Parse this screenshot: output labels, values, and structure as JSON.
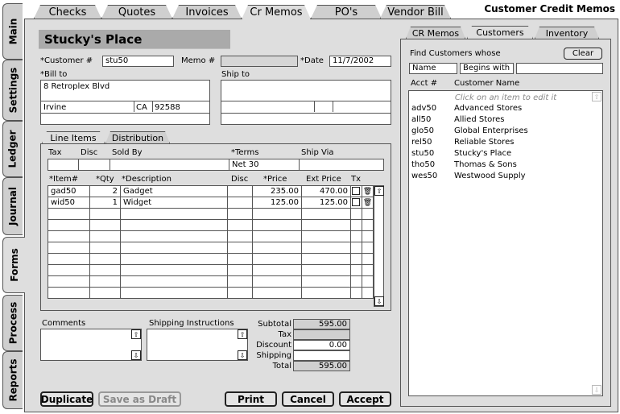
{
  "app_title": "Customer Credit Memos",
  "top_tabs": [
    "Checks",
    "Quotes",
    "Invoices",
    "Cr Memos",
    "PO's",
    "Vendor Bill"
  ],
  "side_tabs": [
    "Main",
    "Settings",
    "Ledger",
    "Journal",
    "Forms",
    "Process",
    "Reports"
  ],
  "form": {
    "title": "Stucky's Place",
    "customer_label": "*Customer #",
    "customer_value": "stu50",
    "memo_label": "Memo #",
    "memo_value": "",
    "date_label": "*Date",
    "date_value": "11/7/2002",
    "bill_to_label": "*Bill to",
    "ship_to_label": "Ship to",
    "bill_street": "8 Retroplex Blvd",
    "bill_city": "Irvine",
    "bill_state": "CA",
    "bill_zip": "92588"
  },
  "inner_tabs": [
    "Line Items",
    "Distribution"
  ],
  "terms": {
    "headers": [
      "Tax",
      "Disc",
      "Sold By",
      "*Terms",
      "Ship Via"
    ],
    "terms_value": "Net 30"
  },
  "items": {
    "headers": [
      "*Item#",
      "*Qty",
      "*Description",
      "Disc",
      "*Price",
      "Ext Price",
      "Tx"
    ],
    "rows": [
      {
        "item": "gad50",
        "qty": "2",
        "desc": "Gadget",
        "disc": "",
        "price": "235.00",
        "ext": "470.00"
      },
      {
        "item": "wid50",
        "qty": "1",
        "desc": "Widget",
        "disc": "",
        "price": "125.00",
        "ext": "125.00"
      }
    ]
  },
  "comments_label": "Comments",
  "shipping_label": "Shipping Instructions",
  "totals": {
    "subtotal_label": "Subtotal",
    "subtotal": "595.00",
    "tax_label": "Tax",
    "tax": "",
    "discount_label": "Discount",
    "discount": "0.00",
    "shipping_label": "Shipping",
    "shipping": "",
    "total_label": "Total",
    "total": "595.00"
  },
  "buttons": {
    "duplicate": "Duplicate",
    "save_draft": "Save as Draft",
    "print": "Print",
    "cancel": "Cancel",
    "accept": "Accept"
  },
  "right_panel": {
    "tabs": [
      "CR Memos",
      "Customers",
      "Inventory"
    ],
    "find_label": "Find Customers whose",
    "clear": "Clear",
    "field_select": "Name",
    "op_select": "Begins with",
    "search_value": "",
    "col_acct": "Acct #",
    "col_name": "Customer Name",
    "hint": "Click on an item to edit it",
    "customers": [
      {
        "acct": "adv50",
        "name": "Advanced Stores"
      },
      {
        "acct": "all50",
        "name": "Allied Stores"
      },
      {
        "acct": "glo50",
        "name": "Global Enterprises"
      },
      {
        "acct": "rel50",
        "name": "Reliable Stores"
      },
      {
        "acct": "stu50",
        "name": "Stucky's Place"
      },
      {
        "acct": "tho50",
        "name": "Thomas & Sons"
      },
      {
        "acct": "wes50",
        "name": "Westwood Supply"
      }
    ]
  }
}
